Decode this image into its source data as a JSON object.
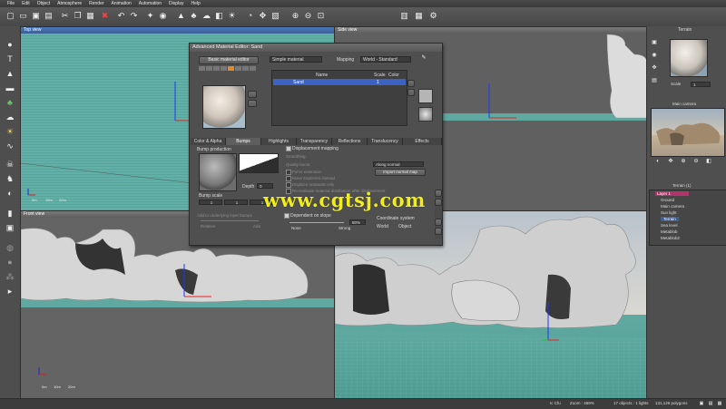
{
  "menu": [
    "File",
    "Edit",
    "Object",
    "Atmosphere",
    "Render",
    "Animation",
    "Automation",
    "Display",
    "Help"
  ],
  "toolbar_icons": [
    "new-icon",
    "open-icon",
    "save-icon",
    "save-as-icon",
    "cut-icon",
    "copy-icon",
    "paste-icon",
    "delete-icon",
    "undo-icon",
    "redo-icon",
    "render-icon",
    "preview-icon",
    "terrain-icon",
    "plant-icon",
    "cloud-icon",
    "camera-icon",
    "light-icon",
    "gauge-icon",
    "move-icon",
    "select-icon",
    "zoom-in-icon",
    "zoom-out-icon",
    "frame-icon",
    "film-icon",
    "grid-icon",
    "settings-icon"
  ],
  "viewports": {
    "top": {
      "title": "Top view"
    },
    "side": {
      "title": "Side view"
    },
    "front": {
      "title": "Front view"
    },
    "main": {
      "title": ""
    }
  },
  "scale_labels": {
    "a": "0m",
    "b": "10m",
    "c": "20m"
  },
  "dialog": {
    "title": "Advanced Material Editor: Sand",
    "basic_btn": "Basic material editor",
    "type_select": "Simple material",
    "mapping_label": "Mapping",
    "mapping_select": "World - Standard",
    "table_headers": {
      "name": "Name",
      "scale": "Scale",
      "color": "Color"
    },
    "row": {
      "name": "Sand",
      "scale": "1"
    },
    "tabs": [
      "Color & Alpha",
      "Bumps",
      "Highlights",
      "Transparency",
      "Reflections",
      "Translucency",
      "Effects"
    ],
    "bump_production": "Bump production",
    "bump_scale": "Bump scale",
    "bump_values": [
      "1",
      "1",
      "1"
    ],
    "depth_label": "Depth",
    "depth_value": "0",
    "displacement": "Displacement mapping",
    "smoothing": "Smoothing",
    "quality_boost": "Quality boost",
    "force_extension": "Force extension",
    "move_explorer": "Move Explorers instead",
    "displace_out": "Displace outwards only",
    "reevaluate": "Re-evaluate material distribution after displacement",
    "along_normal": "Along normal",
    "import_normal": "Import normal map",
    "add_bumps": "Add to underlying layer bumps",
    "relative": "Relative",
    "add": "Add",
    "dependent_slope": "Dependent on slope",
    "none": "None",
    "strong": "Strong",
    "slope_value": "80%",
    "coord_system": "Coordinate system",
    "world": "World",
    "object": "Object"
  },
  "right_panel": {
    "title": "Terrain",
    "scale_label": "Scale",
    "scale_value": "1",
    "camera_title": "Main camera",
    "tree_title": "Terrain (1)",
    "tree": [
      "Layer 1",
      "Ground",
      "Main camera",
      "Sun light",
      "Terrain",
      "Sea level",
      "Metablob",
      "Metablob2"
    ]
  },
  "status": {
    "left": "Ic Cfu",
    "zoom": "Zoom : 469%",
    "objects": "17 objects : 1 lights",
    "polygons": "131,126 polygons"
  },
  "watermark": "www.cgtsj.com",
  "colors": {
    "ground": "#5fa9a0",
    "sky": "#c7d0d7",
    "rock": "#d7d7d7",
    "accent": "#4a78b8"
  }
}
